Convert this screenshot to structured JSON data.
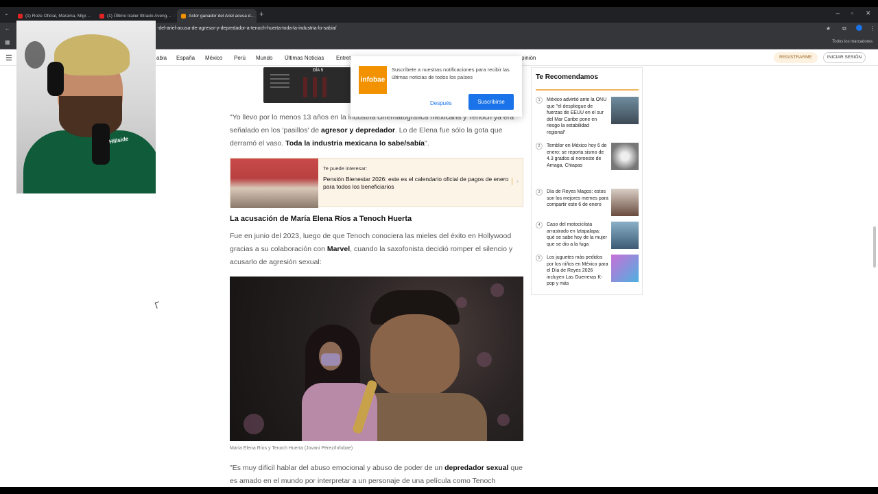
{
  "browser": {
    "tabs": [
      {
        "label": "(1) Roze Oficial, Marama, Migr…",
        "active": false
      },
      {
        "label": "(1) Último trailer filtrado Aveng…",
        "active": false
      },
      {
        "label": "Actor ganador del Ariel acusa d…",
        "active": true
      }
    ],
    "url": "-del-ariel-acusa-de-agresor-y-depredador-a-tenoch-huerta-toda-la-industria-lo-sabia/",
    "bookmarks_label": "Todos los marcadores"
  },
  "site_nav": {
    "items": [
      "abia",
      "España",
      "México",
      "Perú",
      "Mundo",
      "Últimas Noticias",
      "Entret",
      "pinión"
    ],
    "register": "REGISTRARME",
    "login": "INICIAR SESIÓN"
  },
  "infographic": {
    "day_label": "DÍA 5"
  },
  "article": {
    "p1_a": "\"Yo llevo por lo menos 13 años en la industria cinematográfica mexicana y Tenoch ya era señalado en los 'pasillos' de ",
    "p1_b": "agresor y depredador",
    "p1_c": ". Lo de Elena fue sólo la gota que derramó el vaso. ",
    "p1_d": "Toda la industria mexicana lo sabe/sabía",
    "p1_e": "\".",
    "promo_head": "Te puede interesar:",
    "promo_title": "Pensión Bienestar 2026: este es el calendario oficial de pagos de enero para todos los beneficiarios",
    "promo_arrow": "›",
    "heading": "La acusación de María Elena Ríos a Tenoch Huerta",
    "p2_a": "Fue en junio del 2023, luego de que Tenoch conociera las mieles del éxito en Hollywood gracias a su colaboración con ",
    "p2_b": "Marvel",
    "p2_c": ", cuando la saxofonista decidió romper el silencio y acusarlo de agresión sexual:",
    "caption": "María Elena Ríos y Tenoch Huerta (Jovani Pérez/Infobae)",
    "p3_a": "\"Es muy difícil hablar del abuso emocional y abuso de poder de un ",
    "p3_b": "depredador sexual",
    "p3_c": " que es amado en el mundo por interpretar a un personaje de una película como Tenoch"
  },
  "sidebar": {
    "title": "Te Recomendamos",
    "items": [
      {
        "num": "1",
        "text": "México advirtió ante la ONU que \"el despliegue de fuerzas de EEUU en el sur del Mar Caribe pone en riesgo la estabilidad regional\""
      },
      {
        "num": "2",
        "text": "Temblor en México hoy 6 de enero: se reporta sismo de 4.3 grados al noroeste de Arriaga, Chiapas"
      },
      {
        "num": "3",
        "text": "Día de Reyes Magos: estos son los mejores memes para compartir este 6 de enero"
      },
      {
        "num": "4",
        "text": "Caso del motociclista arrastrado en Iztapalapa: qué se sabe hoy de la mujer que se dio a la fuga"
      },
      {
        "num": "5",
        "text": "Los juguetes más pedidos por los niños en México para el Día de Reyes 2026 incluyen Las Guerreras K-pop y más"
      }
    ]
  },
  "notification": {
    "logo": "infobae",
    "text": "Suscríbete a nuestras notificaciones para recibir las últimas noticias de todos los países",
    "later": "Después",
    "subscribe": "Suscribirse"
  },
  "webcam": {
    "shirt_logo": "Hillside"
  },
  "colors": {
    "accent": "#f29200",
    "primary_button": "#1a73e8",
    "rule": "#f0b45b"
  }
}
